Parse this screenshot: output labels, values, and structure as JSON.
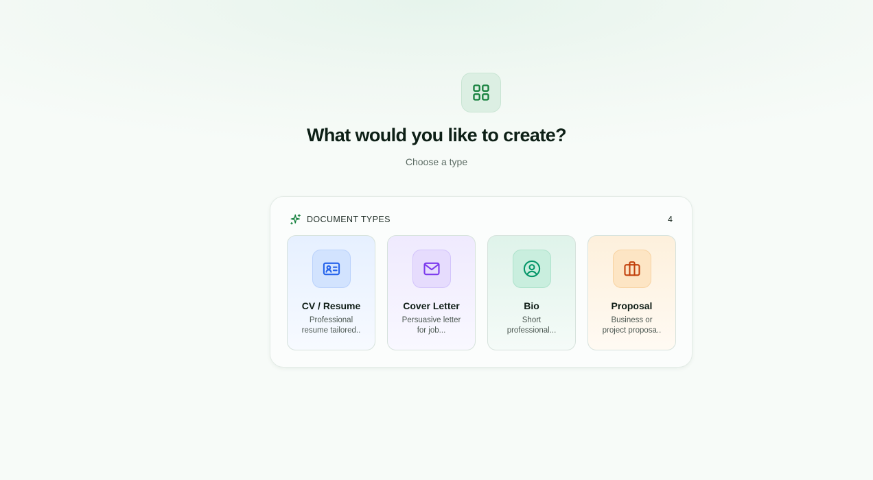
{
  "hero": {
    "icon": "grid-icon",
    "title": "What would you like to create?",
    "subtitle": "Choose a type"
  },
  "panel": {
    "icon": "sparkle-icon",
    "title": "DOCUMENT TYPES",
    "count": "4"
  },
  "cards": [
    {
      "name": "CV / Resume",
      "description": "Professional resume tailored..",
      "icon": "id-card-icon",
      "accent": "#2563eb"
    },
    {
      "name": "Cover Letter",
      "description": "Persuasive letter for job...",
      "icon": "mail-icon",
      "accent": "#7c3aed"
    },
    {
      "name": "Bio",
      "description": "Short professional...",
      "icon": "user-circle-icon",
      "accent": "#059669"
    },
    {
      "name": "Proposal",
      "description": "Business or project proposa..",
      "icon": "briefcase-icon",
      "accent": "#c2410c"
    }
  ],
  "colors": {
    "brand": "#15803d",
    "background": "#f7fbf8"
  }
}
